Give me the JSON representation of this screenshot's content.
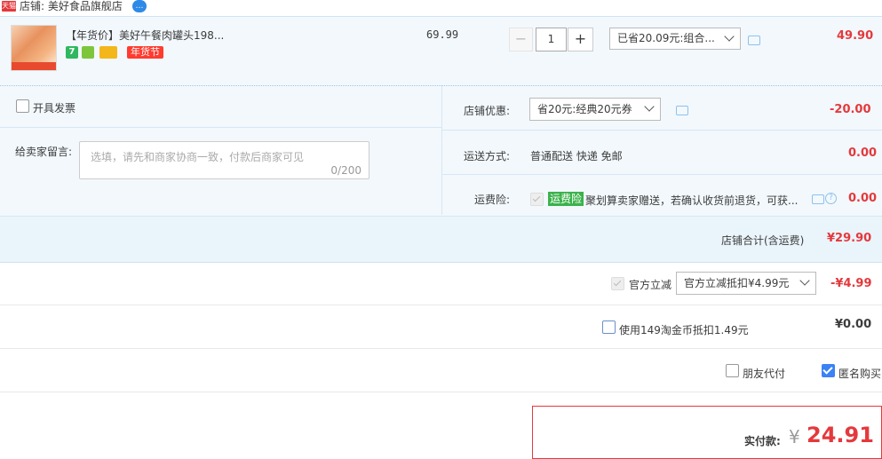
{
  "shop": {
    "tmall_logo": "天猫",
    "label": "店铺: 美好食品旗舰店",
    "chat_icon": "chat-bubble-icon"
  },
  "item": {
    "title": "【年货价】美好午餐肉罐头198...",
    "icons": [
      "seven-day-return-icon",
      "leaf-badge-icon",
      "card-payment-icon"
    ],
    "seven_day_text": "7",
    "festival_tag": "年货节",
    "unit_price": "69.99",
    "qty_minus": "−",
    "quantity": "1",
    "qty_plus": "+",
    "promo_select": "已省20.09元:组合...",
    "total": "49.90"
  },
  "invoice": {
    "label": "开具发票",
    "checked": false
  },
  "message": {
    "label": "给卖家留言:",
    "placeholder": "选填，请先和商家协商一致，付款后商家可见",
    "counter": "0/200"
  },
  "shop_discount": {
    "label": "店铺优惠:",
    "select": "省20元:经典20元券",
    "amount": "-20.00"
  },
  "shipping": {
    "label": "运送方式:",
    "value": "普通配送 快递 免邮",
    "amount": "0.00"
  },
  "insurance": {
    "label": "运费险:",
    "tag": "运费险",
    "text": "聚划算卖家赠送，若确认收货前退货，可获...",
    "amount": "0.00",
    "help_symbol": "?"
  },
  "shop_total": {
    "label": "店铺合计(含运费)",
    "amount": "¥29.90"
  },
  "platform_discount": {
    "label": "官方立减",
    "select": "官方立减抵扣¥4.99元",
    "amount": "-¥4.99"
  },
  "coins": {
    "label": "使用149淘金币抵扣1.49元",
    "amount": "¥0.00"
  },
  "options": {
    "friend_pay": "朋友代付",
    "anonymous": "匿名购买"
  },
  "payment": {
    "label": "实付款:",
    "currency": "¥",
    "amount": "24.91"
  },
  "colors": {
    "accent_red": "#e4393c",
    "panel_bg": "#f2f8fc",
    "checkbox_blue": "#3b82f6",
    "insurance_green": "#3bb24b"
  }
}
